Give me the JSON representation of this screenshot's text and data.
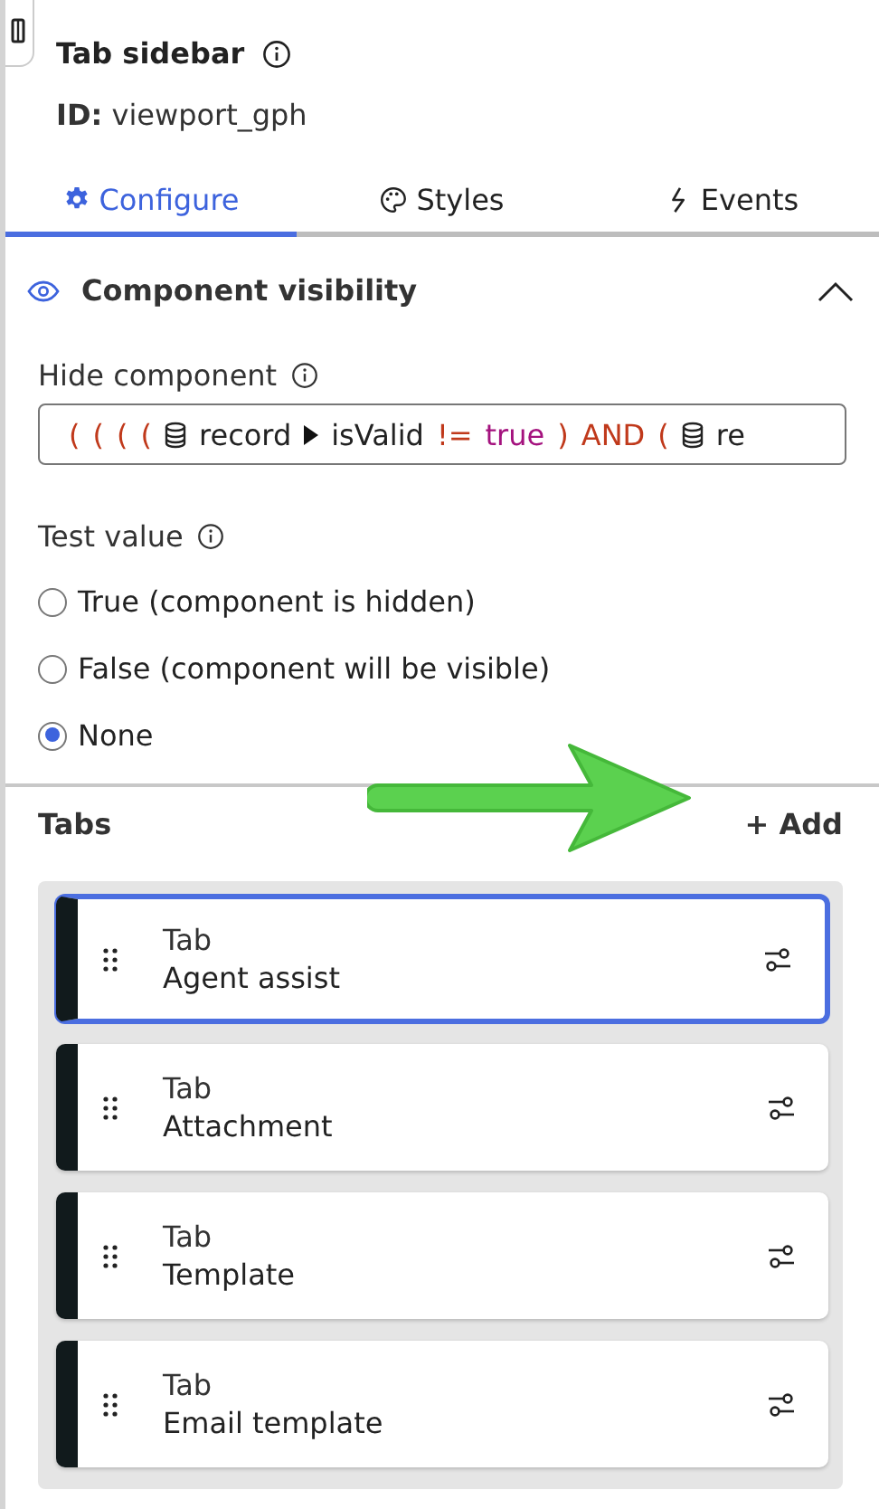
{
  "header": {
    "title": "Tab sidebar",
    "id_label": "ID:",
    "id_value": "viewport_gph"
  },
  "tabs": [
    {
      "label": "Configure",
      "selected": true
    },
    {
      "label": "Styles",
      "selected": false
    },
    {
      "label": "Events",
      "selected": false
    }
  ],
  "section": {
    "title": "Component visibility",
    "expanded": true
  },
  "hide_component": {
    "label": "Hide component",
    "expression": [
      {
        "kind": "paren",
        "text": "("
      },
      {
        "kind": "paren",
        "text": "("
      },
      {
        "kind": "paren",
        "text": "("
      },
      {
        "kind": "paren",
        "text": "("
      },
      {
        "kind": "field",
        "text": "record"
      },
      {
        "kind": "path",
        "text": "isValid"
      },
      {
        "kind": "operator",
        "text": "!="
      },
      {
        "kind": "literal",
        "text": "true"
      },
      {
        "kind": "paren",
        "text": ")"
      },
      {
        "kind": "keyword",
        "text": "AND"
      },
      {
        "kind": "paren",
        "text": "("
      },
      {
        "kind": "field",
        "text": "re"
      }
    ]
  },
  "test_value": {
    "label": "Test value",
    "options": [
      {
        "label": "True (component is hidden)",
        "selected": false
      },
      {
        "label": "False (component will be visible)",
        "selected": false
      },
      {
        "label": "None",
        "selected": true
      }
    ]
  },
  "tabs_list": {
    "title": "Tabs",
    "add_label": "+ Add",
    "items": [
      {
        "type": "Tab",
        "name": "Agent assist",
        "selected": true
      },
      {
        "type": "Tab",
        "name": "Attachment",
        "selected": false
      },
      {
        "type": "Tab",
        "name": "Template",
        "selected": false
      },
      {
        "type": "Tab",
        "name": "Email template",
        "selected": false
      }
    ]
  }
}
